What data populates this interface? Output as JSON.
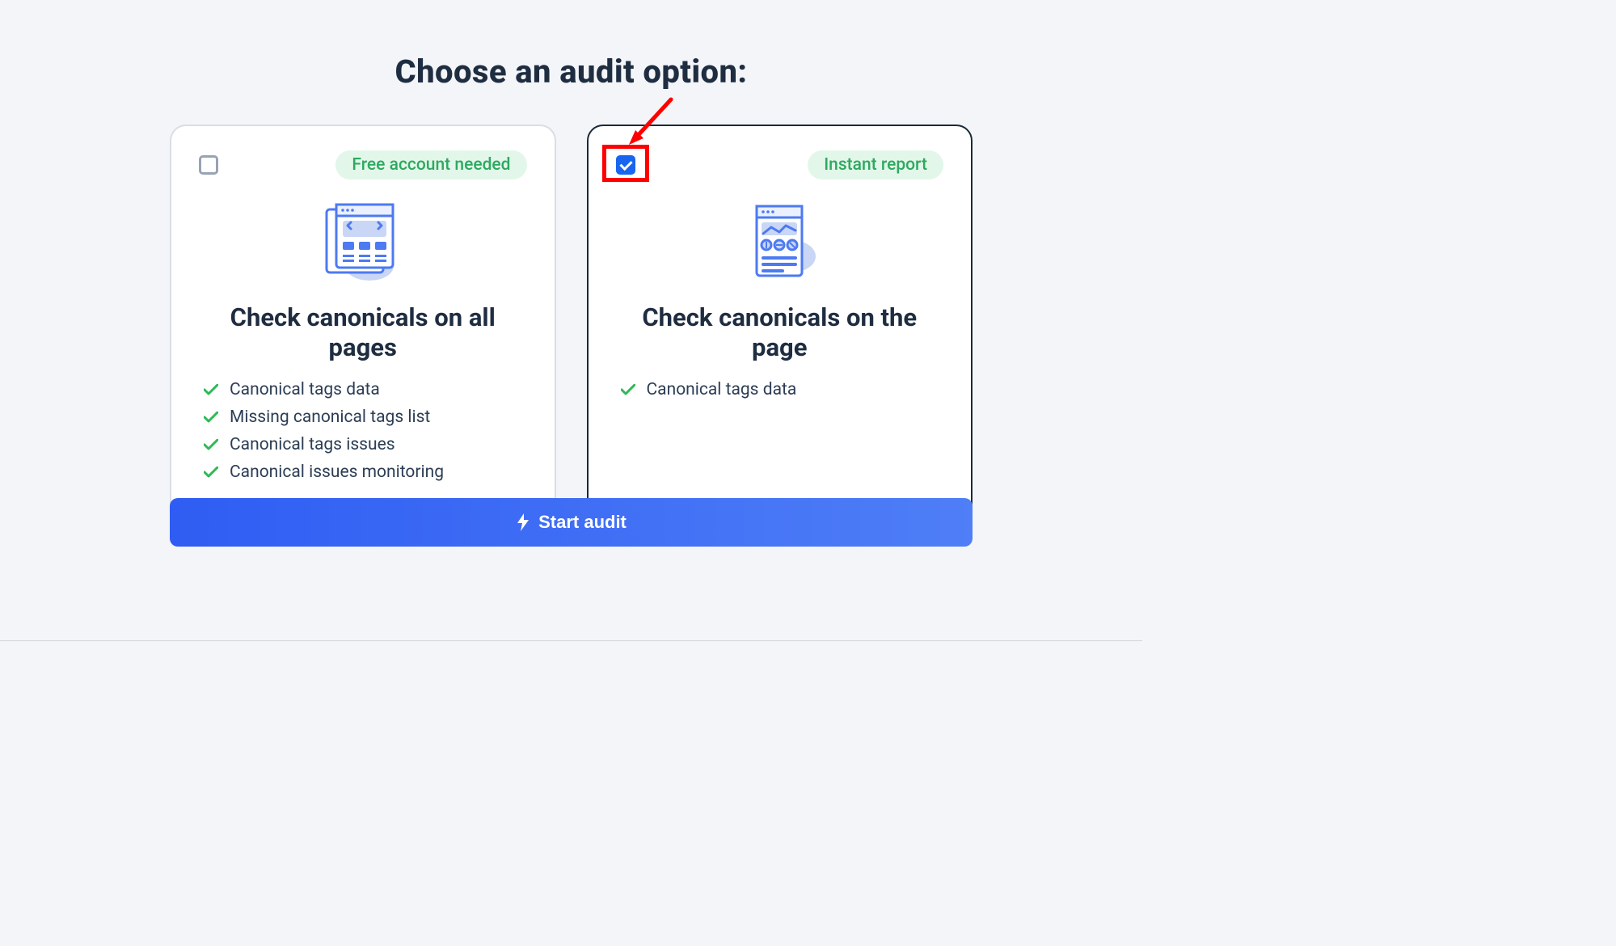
{
  "heading": "Choose an audit option:",
  "cards": [
    {
      "badge": "Free account needed",
      "title": "Check canonicals on all pages",
      "checked": false,
      "features": [
        "Canonical tags data",
        "Missing canonical tags list",
        "Canonical tags issues",
        "Canonical issues monitoring"
      ]
    },
    {
      "badge": "Instant report",
      "title": "Check canonicals on the page",
      "checked": true,
      "features": [
        "Canonical tags data"
      ]
    }
  ],
  "start_button": "Start audit"
}
